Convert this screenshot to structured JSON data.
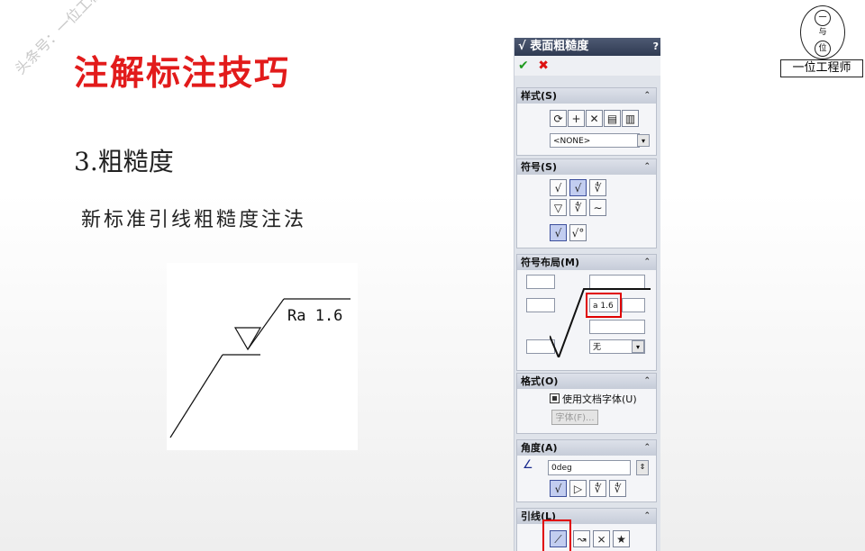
{
  "slide": {
    "title": "注解标注技巧",
    "watermark": "头条号：一位工程师",
    "section": "3.粗糙度",
    "subtitle": "新标准引线粗糙度注法",
    "diagram_label": "Ra 1.6",
    "logo_text": "一位工程师",
    "logo_glyphs": [
      "一",
      "与",
      "位"
    ]
  },
  "panel": {
    "title": "表面粗糙度",
    "help_glyph": "?",
    "ok_glyph": "✔",
    "cancel_glyph": "✖",
    "style_group": {
      "label": "样式(S)",
      "preset_value": "<NONE>"
    },
    "symbol_group": {
      "label": "符号(S)"
    },
    "layout_group": {
      "label": "符号布局(M)",
      "roughness_value": "a 1.6",
      "lay_direction_value": "无"
    },
    "format_group": {
      "label": "格式(O)",
      "use_doc_font_label": "使用文档字体(U)",
      "font_button_label": "字体(F)..."
    },
    "angle_group": {
      "label": "角度(A)",
      "angle_value": "0deg"
    },
    "leader_group": {
      "label": "引线(L)"
    }
  },
  "icons": {
    "ok": "check-icon",
    "cancel": "x-icon",
    "collapse": "chevron-up-icon"
  },
  "colors": {
    "title_red": "#e21b1b",
    "highlight_red": "#e00000",
    "panel_header": "#3a4560",
    "ok_green": "#1f9a1f"
  }
}
